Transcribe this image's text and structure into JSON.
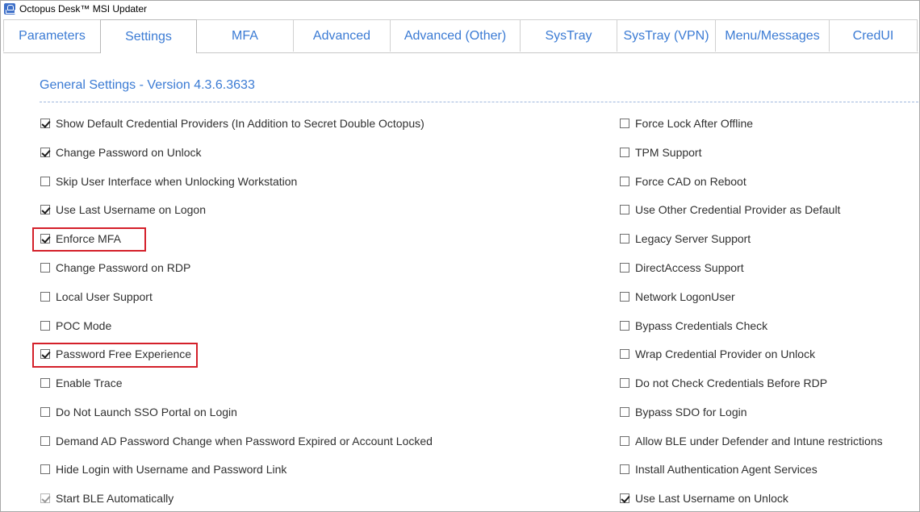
{
  "window": {
    "title": "Octopus Desk™ MSI Updater",
    "icon": "people-icon"
  },
  "tabs": [
    {
      "label": "Parameters",
      "active": false
    },
    {
      "label": "Settings",
      "active": true
    },
    {
      "label": "MFA",
      "active": false
    },
    {
      "label": "Advanced",
      "active": false
    },
    {
      "label": "Advanced (Other)",
      "active": false
    },
    {
      "label": "SysTray",
      "active": false
    },
    {
      "label": "SysTray (VPN)",
      "active": false
    },
    {
      "label": "Menu/Messages",
      "active": false
    },
    {
      "label": "CredUI",
      "active": false
    }
  ],
  "section": {
    "title": "General Settings - Version 4.3.6.3633"
  },
  "left_options": [
    {
      "label": "Show Default Credential Providers (In Addition to Secret Double Octopus)",
      "checked": true
    },
    {
      "label": "Change Password on Unlock",
      "checked": true
    },
    {
      "label": "Skip User Interface when Unlocking Workstation",
      "checked": false
    },
    {
      "label": "Use Last Username on Logon",
      "checked": true
    },
    {
      "label": "Enforce MFA",
      "checked": true,
      "highlighted": true
    },
    {
      "label": "Change Password on RDP",
      "checked": false
    },
    {
      "label": "Local User Support",
      "checked": false
    },
    {
      "label": "POC Mode",
      "checked": false
    },
    {
      "label": "Password Free Experience",
      "checked": true,
      "highlighted": true
    },
    {
      "label": "Enable Trace",
      "checked": false
    },
    {
      "label": "Do Not Launch SSO Portal on Login",
      "checked": false
    },
    {
      "label": "Demand AD Password Change when Password Expired or Account Locked",
      "checked": false
    },
    {
      "label": "Hide Login with Username and Password Link",
      "checked": false
    },
    {
      "label": "Start BLE Automatically",
      "checked": true,
      "disabled": true
    }
  ],
  "right_options": [
    {
      "label": "Force Lock After Offline",
      "checked": false
    },
    {
      "label": "TPM Support",
      "checked": false
    },
    {
      "label": "Force CAD on Reboot",
      "checked": false
    },
    {
      "label": "Use Other Credential Provider as Default",
      "checked": false
    },
    {
      "label": "Legacy Server Support",
      "checked": false
    },
    {
      "label": "DirectAccess Support",
      "checked": false
    },
    {
      "label": "Network LogonUser",
      "checked": false
    },
    {
      "label": "Bypass Credentials Check",
      "checked": false
    },
    {
      "label": "Wrap Credential Provider on Unlock",
      "checked": false
    },
    {
      "label": "Do not Check Credentials Before RDP",
      "checked": false
    },
    {
      "label": "Bypass SDO for Login",
      "checked": false
    },
    {
      "label": "Allow BLE under Defender and Intune restrictions",
      "checked": false
    },
    {
      "label": "Install Authentication Agent Services",
      "checked": false
    },
    {
      "label": "Use Last Username on Unlock",
      "checked": true
    }
  ],
  "colors": {
    "accent": "#3b7bd4",
    "highlight_box": "#d4202a"
  }
}
